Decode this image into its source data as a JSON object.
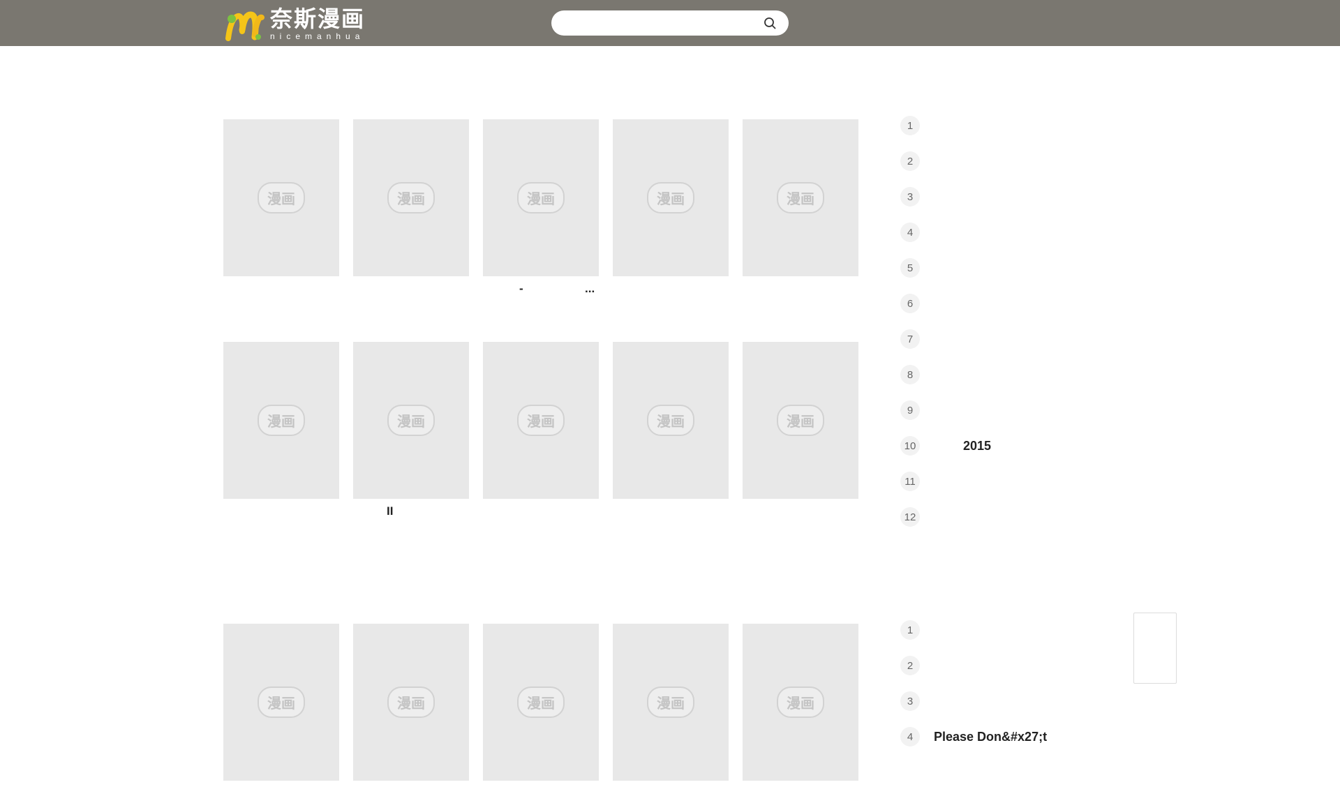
{
  "header": {
    "logo_cn": "奈斯漫画",
    "logo_en": "nicemanhua",
    "search_placeholder": ""
  },
  "placeholder_mark": "漫画",
  "section1": {
    "cards": [
      {
        "title": ""
      },
      {
        "title": ""
      },
      {
        "title": ""
      },
      {
        "title": ""
      },
      {
        "title": ""
      },
      {
        "title": ""
      },
      {
        "title": ""
      },
      {
        "title": ""
      },
      {
        "title": ""
      },
      {
        "title": ""
      }
    ],
    "row1_extra_text": [
      "-",
      "..."
    ],
    "row2_extra_text": [
      "II"
    ],
    "ranking": [
      {
        "num": "1",
        "title": ""
      },
      {
        "num": "2",
        "title": ""
      },
      {
        "num": "3",
        "title": ""
      },
      {
        "num": "4",
        "title": ""
      },
      {
        "num": "5",
        "title": ""
      },
      {
        "num": "6",
        "title": ""
      },
      {
        "num": "7",
        "title": ""
      },
      {
        "num": "8",
        "title": ""
      },
      {
        "num": "9",
        "title": ""
      },
      {
        "num": "10",
        "title": "2015"
      },
      {
        "num": "11",
        "title": ""
      },
      {
        "num": "12",
        "title": ""
      }
    ]
  },
  "section2": {
    "cards": [
      {
        "title": ""
      },
      {
        "title": ""
      },
      {
        "title": ""
      },
      {
        "title": ""
      },
      {
        "title": ""
      }
    ],
    "ranking": [
      {
        "num": "1",
        "title": ""
      },
      {
        "num": "2",
        "title": ""
      },
      {
        "num": "3",
        "title": ""
      },
      {
        "num": "4",
        "title": "Please Don&#x27;t"
      }
    ]
  },
  "colors": {
    "header_bg": "#7a7770",
    "thumb_bg": "#e8e8e8",
    "logo_yellow": "#f5c518",
    "logo_green": "#7cc242"
  }
}
